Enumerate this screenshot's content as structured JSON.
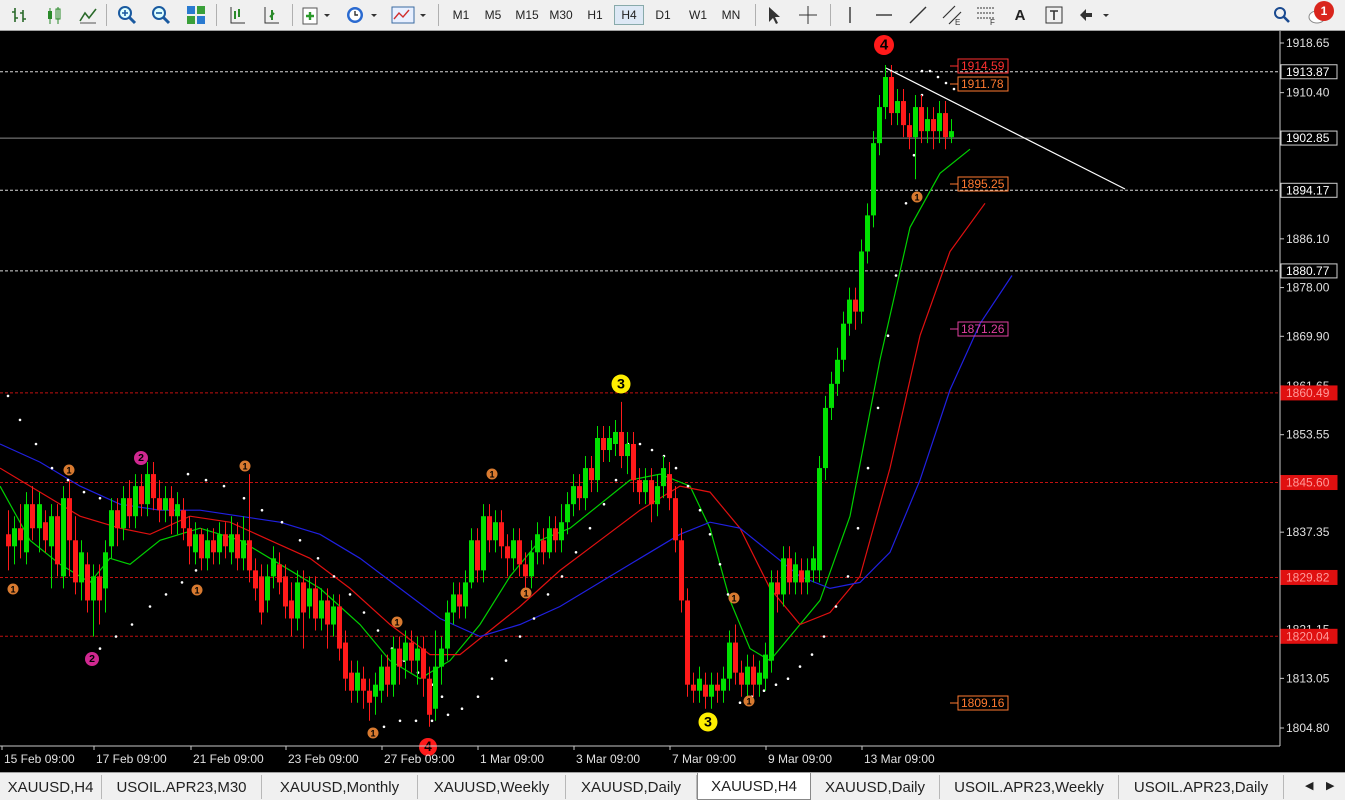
{
  "toolbar": {
    "timeframes": [
      "M1",
      "M5",
      "M15",
      "M30",
      "H1",
      "H4",
      "D1",
      "W1",
      "MN"
    ],
    "active_timeframe": "H4",
    "tools": [
      "bar-chart-icon",
      "candlestick-icon",
      "line-chart-icon",
      "zoom-in-icon",
      "zoom-out-icon",
      "tile-windows-icon",
      "chart-shift-icon",
      "autoscroll-icon",
      "new-order-icon",
      "history-clock-icon",
      "templates-icon",
      "cursor-icon",
      "crosshair-icon",
      "vertical-line-icon",
      "horizontal-line-icon",
      "trendline-icon",
      "channel-icon",
      "fibonacci-icon",
      "text-icon",
      "text-label-icon",
      "arrows-icon"
    ],
    "text_tool_label": "A",
    "notification_count": "1"
  },
  "price_axis": {
    "labels": [
      "1918.65",
      "1910.40",
      "1902.85",
      "1886.10",
      "1878.00",
      "1869.90",
      "1861.65",
      "1853.55",
      "1837.35",
      "1821.15",
      "1813.05",
      "1804.80"
    ],
    "tags": [
      {
        "text": "1913.87",
        "kind": "white"
      },
      {
        "text": "1902.85",
        "kind": "white"
      },
      {
        "text": "1894.17",
        "kind": "white"
      },
      {
        "text": "1880.77",
        "kind": "white"
      },
      {
        "text": "1860.49",
        "kind": "red"
      },
      {
        "text": "1845.60",
        "kind": "red"
      },
      {
        "text": "1829.82",
        "kind": "red"
      },
      {
        "text": "1820.04",
        "kind": "red"
      }
    ]
  },
  "time_axis": [
    "15 Feb 09:00",
    "17 Feb 09:00",
    "21 Feb 09:00",
    "23 Feb 09:00",
    "27 Feb 09:00",
    "1 Mar 09:00",
    "3 Mar 09:00",
    "7 Mar 09:00",
    "9 Mar 09:00",
    "13 Mar 09:00"
  ],
  "chart_labels": [
    {
      "text": "1914.59",
      "color": "#ff3030"
    },
    {
      "text": "1911.78",
      "color": "#ff7a30"
    },
    {
      "text": "1895.25",
      "color": "#ff7a30"
    },
    {
      "text": "1871.26",
      "color": "#e040a0"
    },
    {
      "text": "1809.16",
      "color": "#ff7a30"
    }
  ],
  "wave_markers": [
    {
      "text": "4",
      "color": "#ff1a1a",
      "fg": "#000"
    },
    {
      "text": "3",
      "color": "#ffee00",
      "fg": "#000"
    },
    {
      "text": "3",
      "color": "#ffee00",
      "fg": "#000"
    },
    {
      "text": "2",
      "color": "#d02890",
      "fg": "#000"
    },
    {
      "text": "2",
      "color": "#d02890",
      "fg": "#000"
    },
    {
      "text": "4",
      "color": "#ff1a1a",
      "fg": "#000"
    }
  ],
  "minor_marker_text": "1",
  "colors": {
    "bull": "#00e000",
    "bear": "#ff1a1a",
    "ma_green": "#00d000",
    "ma_red": "#e01010",
    "ma_blue": "#2020e0",
    "bg": "#000000",
    "grid_red": "#c01010"
  },
  "tabs": [
    {
      "label": "XAUUSD,H4",
      "active": false
    },
    {
      "label": "USOIL.APR23,M30",
      "active": false
    },
    {
      "label": "XAUUSD,Monthly",
      "active": false
    },
    {
      "label": "XAUUSD,Weekly",
      "active": false
    },
    {
      "label": "XAUUSD,Daily",
      "active": false
    },
    {
      "label": "XAUUSD,H4",
      "active": true
    },
    {
      "label": "XAUUSD,Daily",
      "active": false
    },
    {
      "label": "USOIL.APR23,Weekly",
      "active": false
    },
    {
      "label": "USOIL.APR23,Daily",
      "active": false
    }
  ]
}
